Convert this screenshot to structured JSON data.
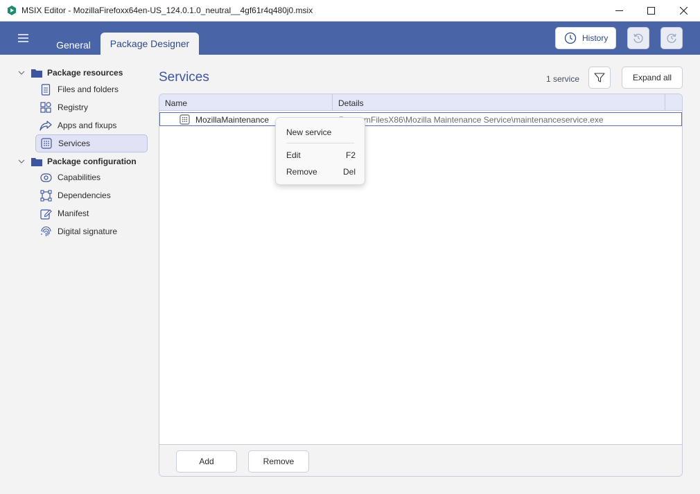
{
  "window": {
    "title": "MSIX Editor - MozillaFirefoxx64en-US_124.0.1.0_neutral__4gf61r4q480j0.msix"
  },
  "header": {
    "tabs": [
      {
        "label": "General",
        "active": false
      },
      {
        "label": "Package Designer",
        "active": true
      }
    ],
    "history_label": "History"
  },
  "sidebar": {
    "groups": [
      {
        "label": "Package resources",
        "items": [
          {
            "label": "Files and folders",
            "icon": "file-icon"
          },
          {
            "label": "Registry",
            "icon": "registry-icon"
          },
          {
            "label": "Apps and fixups",
            "icon": "share-arrow-icon"
          },
          {
            "label": "Services",
            "icon": "services-grid-icon",
            "selected": true
          }
        ]
      },
      {
        "label": "Package configuration",
        "items": [
          {
            "label": "Capabilities",
            "icon": "capabilities-icon"
          },
          {
            "label": "Dependencies",
            "icon": "dependencies-icon"
          },
          {
            "label": "Manifest",
            "icon": "manifest-edit-icon"
          },
          {
            "label": "Digital signature",
            "icon": "fingerprint-icon"
          }
        ]
      }
    ]
  },
  "main": {
    "title": "Services",
    "count_label": "1 service",
    "expand_all_label": "Expand all",
    "table": {
      "columns": [
        "Name",
        "Details"
      ],
      "rows": [
        {
          "name": "MozillaMaintenance",
          "details": "ProgramFilesX86\\Mozilla Maintenance Service\\maintenanceservice.exe"
        }
      ]
    },
    "footer": {
      "add_label": "Add",
      "remove_label": "Remove"
    }
  },
  "context_menu": {
    "items": [
      {
        "label": "New service",
        "shortcut": ""
      },
      {
        "label": "Edit",
        "shortcut": "F2"
      },
      {
        "label": "Remove",
        "shortcut": "Del"
      }
    ]
  },
  "colors": {
    "accent": "#4a64a8",
    "title_blue": "#3d55a0",
    "selection": "#dfe3f5"
  }
}
